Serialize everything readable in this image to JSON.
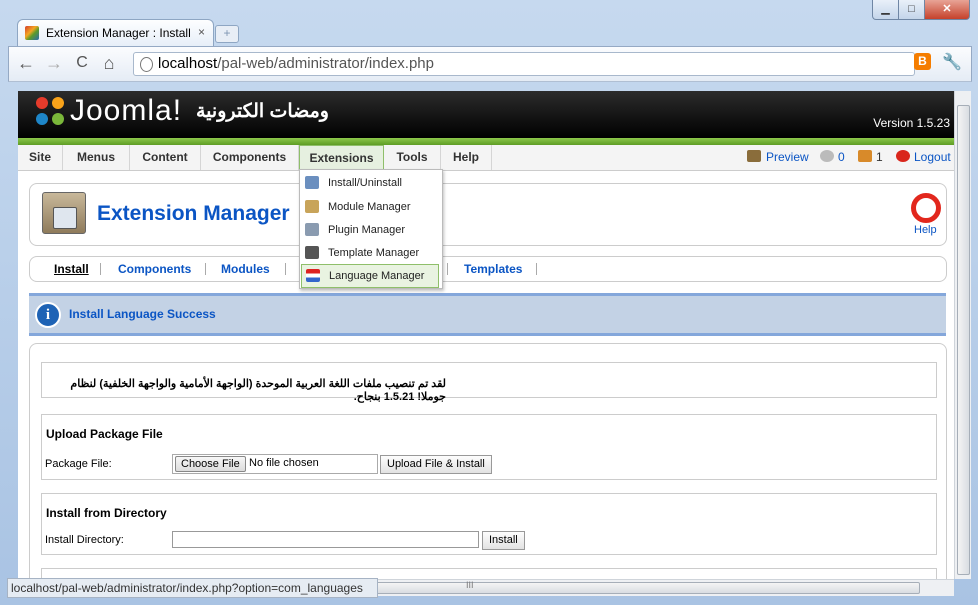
{
  "browser": {
    "tab_title": "Extension Manager : Install",
    "tab_close": "×",
    "new_tab": "+",
    "window_buttons": {
      "minimize": "▁",
      "maximize": "□",
      "close": "✕"
    },
    "nav": {
      "back": "←",
      "forward": "→",
      "reload": "C",
      "home": "⌂"
    },
    "url_host": "localhost",
    "url_path": "/pal-web/administrator/index.php",
    "star": "☆",
    "blogger": "B",
    "wrench": "🔧",
    "status_url": "localhost/pal-web/administrator/index.php?option=com_languages",
    "hscroll_grip": "III"
  },
  "joomla": {
    "logo_text": "Joomla!",
    "site_name": "ومضات الكترونية",
    "version": "Version 1.5.23",
    "menu": [
      "Site",
      "Menus",
      "Content",
      "Components",
      "Extensions",
      "Tools",
      "Help"
    ],
    "status": {
      "preview": "Preview",
      "messages": "0",
      "users": "1",
      "logout": "Logout"
    },
    "dropdown": [
      "Install/Uninstall",
      "Module Manager",
      "Plugin Manager",
      "Template Manager",
      "Language Manager"
    ],
    "page_title": "Extension Manager",
    "help": "Help",
    "submenu": [
      "Install",
      "Components",
      "Modules",
      "Templates"
    ],
    "message": "Install Language Success",
    "info_glyph": "i",
    "install_result": "لقد تم تنصيب ملفات اللغة العربية الموحدة (الواجهة الأمامية والواجهة الخلفية) لنظام جوملا! 1.5.21 بنجاح.",
    "upload": {
      "title": "Upload Package File",
      "label": "Package File:",
      "choose": "Choose File",
      "no_file": "No file chosen",
      "button": "Upload File & Install"
    },
    "directory": {
      "title": "Install from Directory",
      "label": "Install Directory:",
      "value": "",
      "button": "Install"
    }
  },
  "colors": {
    "joomla_blue": "#0b55c4",
    "joomla_green": "#6aaa2f",
    "message_bg": "#c3d2e5"
  }
}
